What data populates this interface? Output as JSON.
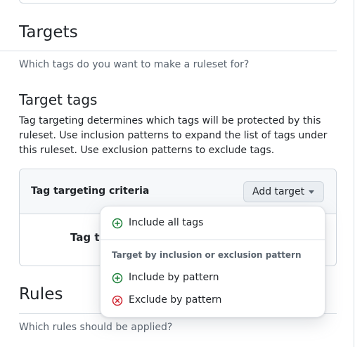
{
  "targets": {
    "heading": "Targets",
    "description": "Which tags do you want to make a ruleset for?"
  },
  "target_tags": {
    "heading": "Target tags",
    "description": "Tag targeting determines which tags will be protected by this ruleset. Use inclusion patterns to expand the list of tags under this ruleset. Use exclusion patterns to exclude tags."
  },
  "criteria": {
    "title": "Tag targeting criteria",
    "add_target_label": "Add target",
    "empty_label_partial": "Tag ta"
  },
  "dropdown": {
    "include_all": "Include all tags",
    "group_label": "Target by inclusion or exclusion pattern",
    "include_pattern": "Include by pattern",
    "exclude_pattern": "Exclude by pattern",
    "icons": {
      "include": "plus-circle-icon",
      "exclude": "x-circle-icon"
    },
    "colors": {
      "include": "#1a7f37",
      "exclude": "#cf222e"
    }
  },
  "rules": {
    "heading": "Rules",
    "description": "Which rules should be applied?"
  }
}
